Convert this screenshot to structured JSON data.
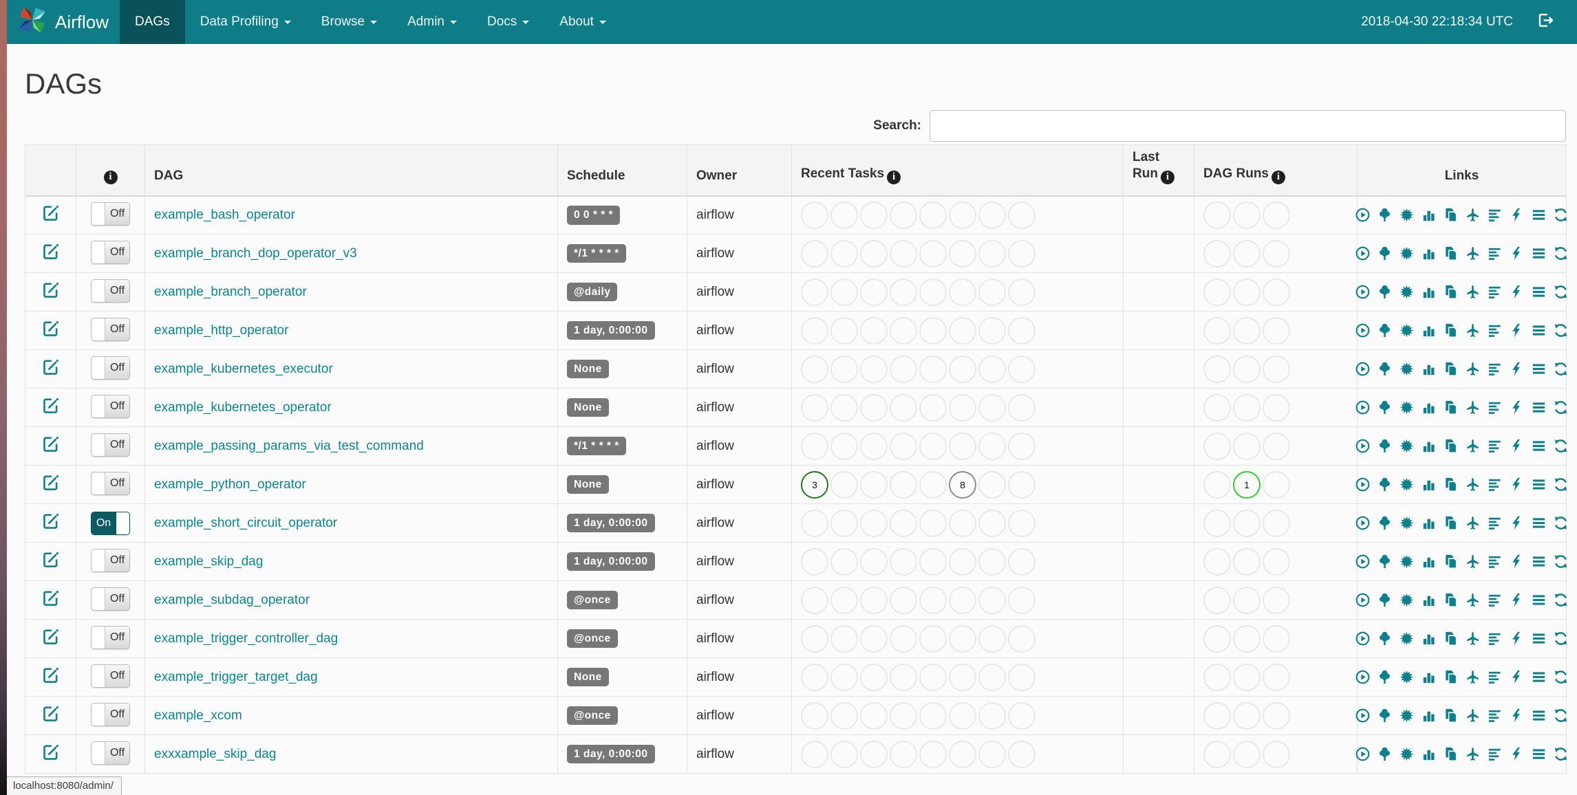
{
  "colors": {
    "navbar_bg": "#0e7d87",
    "navbar_active_bg": "#09525a",
    "link_teal": "#0d8591",
    "schedule_badge_bg": "#777777",
    "toggle_on_bg": "#0c5a63",
    "task_success_green": "#1f7a1f",
    "task_queued_gray": "#8c8c8c",
    "dagrun_running_green": "#32cd32"
  },
  "navbar": {
    "brand": "Airflow",
    "items": [
      {
        "label": "DAGs",
        "active": true,
        "caret": false
      },
      {
        "label": "Data Profiling",
        "active": false,
        "caret": true
      },
      {
        "label": "Browse",
        "active": false,
        "caret": true
      },
      {
        "label": "Admin",
        "active": false,
        "caret": true
      },
      {
        "label": "Docs",
        "active": false,
        "caret": true
      },
      {
        "label": "About",
        "active": false,
        "caret": true
      }
    ],
    "clock": "2018-04-30 22:18:34 UTC"
  },
  "page": {
    "title": "DAGs",
    "search_label": "Search:",
    "search_value": "",
    "status_url": "localhost:8080/admin/"
  },
  "table": {
    "headers": {
      "edit": "",
      "dag": "DAG",
      "schedule": "Schedule",
      "owner": "Owner",
      "recent_tasks": "Recent Tasks",
      "last_run": "Last Run",
      "dag_runs": "DAG Runs",
      "links": "Links"
    },
    "recent_task_slots": 8,
    "dag_run_slots": 3,
    "link_icons": [
      "trigger-dag-icon",
      "tree-view-icon",
      "graph-view-icon",
      "task-duration-icon",
      "task-tries-icon",
      "landing-times-icon",
      "gantt-view-icon",
      "code-view-icon",
      "logs-icon",
      "refresh-icon"
    ],
    "rows": [
      {
        "dag_id": "example_bash_operator",
        "toggle_label": "Off",
        "enabled": false,
        "schedule": "0 0 * * *",
        "owner": "airflow",
        "last_run": "",
        "recent_tasks": [],
        "dag_runs": []
      },
      {
        "dag_id": "example_branch_dop_operator_v3",
        "toggle_label": "Off",
        "enabled": false,
        "schedule": "*/1 * * * *",
        "owner": "airflow",
        "last_run": "",
        "recent_tasks": [],
        "dag_runs": []
      },
      {
        "dag_id": "example_branch_operator",
        "toggle_label": "Off",
        "enabled": false,
        "schedule": "@daily",
        "owner": "airflow",
        "last_run": "",
        "recent_tasks": [],
        "dag_runs": []
      },
      {
        "dag_id": "example_http_operator",
        "toggle_label": "Off",
        "enabled": false,
        "schedule": "1 day, 0:00:00",
        "owner": "airflow",
        "last_run": "",
        "recent_tasks": [],
        "dag_runs": []
      },
      {
        "dag_id": "example_kubernetes_executor",
        "toggle_label": "Off",
        "enabled": false,
        "schedule": "None",
        "owner": "airflow",
        "last_run": "",
        "recent_tasks": [],
        "dag_runs": []
      },
      {
        "dag_id": "example_kubernetes_operator",
        "toggle_label": "Off",
        "enabled": false,
        "schedule": "None",
        "owner": "airflow",
        "last_run": "",
        "recent_tasks": [],
        "dag_runs": []
      },
      {
        "dag_id": "example_passing_params_via_test_command",
        "toggle_label": "Off",
        "enabled": false,
        "schedule": "*/1 * * * *",
        "owner": "airflow",
        "last_run": "",
        "recent_tasks": [],
        "dag_runs": []
      },
      {
        "dag_id": "example_python_operator",
        "toggle_label": "Off",
        "enabled": false,
        "schedule": "None",
        "owner": "airflow",
        "last_run": "",
        "recent_tasks": [
          {
            "slot": 0,
            "count": "3",
            "color": "#1f7a1f"
          },
          {
            "slot": 5,
            "count": "8",
            "color": "#8c8c8c"
          }
        ],
        "dag_runs": [
          {
            "slot": 1,
            "count": "1",
            "color": "#32cd32"
          }
        ]
      },
      {
        "dag_id": "example_short_circuit_operator",
        "toggle_label": "On",
        "enabled": true,
        "schedule": "1 day, 0:00:00",
        "owner": "airflow",
        "last_run": "",
        "recent_tasks": [],
        "dag_runs": []
      },
      {
        "dag_id": "example_skip_dag",
        "toggle_label": "Off",
        "enabled": false,
        "schedule": "1 day, 0:00:00",
        "owner": "airflow",
        "last_run": "",
        "recent_tasks": [],
        "dag_runs": []
      },
      {
        "dag_id": "example_subdag_operator",
        "toggle_label": "Off",
        "enabled": false,
        "schedule": "@once",
        "owner": "airflow",
        "last_run": "",
        "recent_tasks": [],
        "dag_runs": []
      },
      {
        "dag_id": "example_trigger_controller_dag",
        "toggle_label": "Off",
        "enabled": false,
        "schedule": "@once",
        "owner": "airflow",
        "last_run": "",
        "recent_tasks": [],
        "dag_runs": []
      },
      {
        "dag_id": "example_trigger_target_dag",
        "toggle_label": "Off",
        "enabled": false,
        "schedule": "None",
        "owner": "airflow",
        "last_run": "",
        "recent_tasks": [],
        "dag_runs": []
      },
      {
        "dag_id": "example_xcom",
        "toggle_label": "Off",
        "enabled": false,
        "schedule": "@once",
        "owner": "airflow",
        "last_run": "",
        "recent_tasks": [],
        "dag_runs": []
      },
      {
        "dag_id": "exxxample_skip_dag",
        "toggle_label": "Off",
        "enabled": false,
        "schedule": "1 day, 0:00:00",
        "owner": "airflow",
        "last_run": "",
        "recent_tasks": [],
        "dag_runs": []
      }
    ]
  }
}
